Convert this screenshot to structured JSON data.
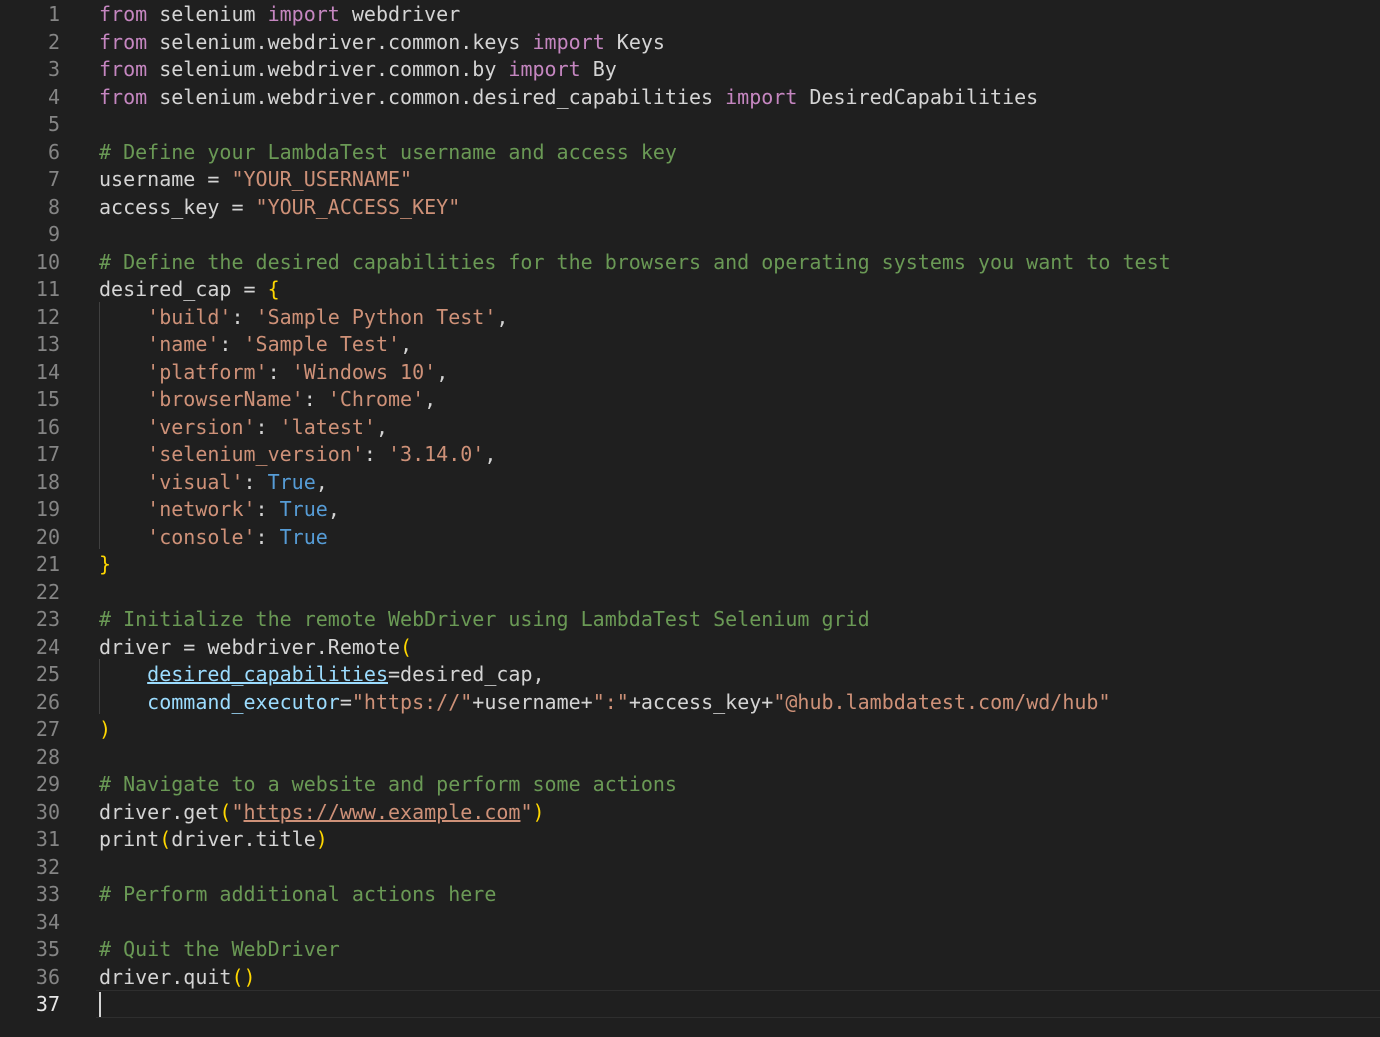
{
  "editor": {
    "language": "python",
    "active_line": 37,
    "colors": {
      "background": "#1f1f1f",
      "keyword": "#c586c0",
      "comment": "#6a9955",
      "string": "#ce9178",
      "constant": "#569cd6",
      "bracket": "#ffd700",
      "parameter": "#9cdcfe",
      "function": "#dcdcaa",
      "text": "#d4d4d4",
      "line_number": "#858585"
    },
    "lines": [
      {
        "n": "1",
        "tokens": [
          [
            "kw",
            "from"
          ],
          [
            "tx",
            " selenium "
          ],
          [
            "kw",
            "import"
          ],
          [
            "tx",
            " webdriver"
          ]
        ]
      },
      {
        "n": "2",
        "tokens": [
          [
            "kw",
            "from"
          ],
          [
            "tx",
            " selenium.webdriver.common.keys "
          ],
          [
            "kw",
            "import"
          ],
          [
            "tx",
            " Keys"
          ]
        ]
      },
      {
        "n": "3",
        "tokens": [
          [
            "kw",
            "from"
          ],
          [
            "tx",
            " selenium.webdriver.common.by "
          ],
          [
            "kw",
            "import"
          ],
          [
            "tx",
            " By"
          ]
        ]
      },
      {
        "n": "4",
        "tokens": [
          [
            "kw",
            "from"
          ],
          [
            "tx",
            " selenium.webdriver.common.desired_capabilities "
          ],
          [
            "kw",
            "import"
          ],
          [
            "tx",
            " DesiredCapabilities"
          ]
        ]
      },
      {
        "n": "5",
        "tokens": []
      },
      {
        "n": "6",
        "tokens": [
          [
            "cm",
            "# Define your LambdaTest username and access key"
          ]
        ]
      },
      {
        "n": "7",
        "tokens": [
          [
            "tx",
            "username = "
          ],
          [
            "st",
            "\"YOUR_USERNAME\""
          ]
        ]
      },
      {
        "n": "8",
        "tokens": [
          [
            "tx",
            "access_key = "
          ],
          [
            "st",
            "\"YOUR_ACCESS_KEY\""
          ]
        ]
      },
      {
        "n": "9",
        "tokens": []
      },
      {
        "n": "10",
        "tokens": [
          [
            "cm",
            "# Define the desired capabilities for the browsers and operating systems you want to test"
          ]
        ]
      },
      {
        "n": "11",
        "tokens": [
          [
            "tx",
            "desired_cap = "
          ],
          [
            "bk",
            "{"
          ]
        ]
      },
      {
        "n": "12",
        "tokens": [
          [
            "tx",
            "    "
          ],
          [
            "st",
            "'build'"
          ],
          [
            "tx",
            ": "
          ],
          [
            "st",
            "'Sample Python Test'"
          ],
          [
            "tx",
            ","
          ]
        ]
      },
      {
        "n": "13",
        "tokens": [
          [
            "tx",
            "    "
          ],
          [
            "st",
            "'name'"
          ],
          [
            "tx",
            ": "
          ],
          [
            "st",
            "'Sample Test'"
          ],
          [
            "tx",
            ","
          ]
        ]
      },
      {
        "n": "14",
        "tokens": [
          [
            "tx",
            "    "
          ],
          [
            "st",
            "'platform'"
          ],
          [
            "tx",
            ": "
          ],
          [
            "st",
            "'Windows 10'"
          ],
          [
            "tx",
            ","
          ]
        ]
      },
      {
        "n": "15",
        "tokens": [
          [
            "tx",
            "    "
          ],
          [
            "st",
            "'browserName'"
          ],
          [
            "tx",
            ": "
          ],
          [
            "st",
            "'Chrome'"
          ],
          [
            "tx",
            ","
          ]
        ]
      },
      {
        "n": "16",
        "tokens": [
          [
            "tx",
            "    "
          ],
          [
            "st",
            "'version'"
          ],
          [
            "tx",
            ": "
          ],
          [
            "st",
            "'latest'"
          ],
          [
            "tx",
            ","
          ]
        ]
      },
      {
        "n": "17",
        "tokens": [
          [
            "tx",
            "    "
          ],
          [
            "st",
            "'selenium_version'"
          ],
          [
            "tx",
            ": "
          ],
          [
            "st",
            "'3.14.0'"
          ],
          [
            "tx",
            ","
          ]
        ]
      },
      {
        "n": "18",
        "tokens": [
          [
            "tx",
            "    "
          ],
          [
            "st",
            "'visual'"
          ],
          [
            "tx",
            ": "
          ],
          [
            "bi",
            "True"
          ],
          [
            "tx",
            ","
          ]
        ]
      },
      {
        "n": "19",
        "tokens": [
          [
            "tx",
            "    "
          ],
          [
            "st",
            "'network'"
          ],
          [
            "tx",
            ": "
          ],
          [
            "bi",
            "True"
          ],
          [
            "tx",
            ","
          ]
        ]
      },
      {
        "n": "20",
        "tokens": [
          [
            "tx",
            "    "
          ],
          [
            "st",
            "'console'"
          ],
          [
            "tx",
            ": "
          ],
          [
            "bi",
            "True"
          ]
        ]
      },
      {
        "n": "21",
        "tokens": [
          [
            "bk",
            "}"
          ]
        ]
      },
      {
        "n": "22",
        "tokens": []
      },
      {
        "n": "23",
        "tokens": [
          [
            "cm",
            "# Initialize the remote WebDriver using LambdaTest Selenium grid"
          ]
        ]
      },
      {
        "n": "24",
        "tokens": [
          [
            "tx",
            "driver = webdriver.Remote"
          ],
          [
            "bk",
            "("
          ]
        ]
      },
      {
        "n": "25",
        "tokens": [
          [
            "tx",
            "    "
          ],
          [
            "pr ul",
            "desired_capabilities"
          ],
          [
            "tx",
            "=desired_cap,"
          ]
        ]
      },
      {
        "n": "26",
        "tokens": [
          [
            "tx",
            "    "
          ],
          [
            "pr",
            "command_executor"
          ],
          [
            "tx",
            "="
          ],
          [
            "st",
            "\"https://\""
          ],
          [
            "tx",
            "+username+"
          ],
          [
            "st",
            "\":\""
          ],
          [
            "tx",
            "+access_key+"
          ],
          [
            "st",
            "\"@hub.lambdatest.com/wd/hub\""
          ]
        ]
      },
      {
        "n": "27",
        "tokens": [
          [
            "bk",
            ")"
          ]
        ]
      },
      {
        "n": "28",
        "tokens": []
      },
      {
        "n": "29",
        "tokens": [
          [
            "cm",
            "# Navigate to a website and perform some actions"
          ]
        ]
      },
      {
        "n": "30",
        "tokens": [
          [
            "tx",
            "driver.get"
          ],
          [
            "bk",
            "("
          ],
          [
            "st",
            "\""
          ],
          [
            "st ul",
            "https://www.example.com"
          ],
          [
            "st",
            "\""
          ],
          [
            "bk",
            ")"
          ]
        ]
      },
      {
        "n": "31",
        "tokens": [
          [
            "tx",
            "print"
          ],
          [
            "bk",
            "("
          ],
          [
            "tx",
            "driver.title"
          ],
          [
            "bk",
            ")"
          ]
        ]
      },
      {
        "n": "32",
        "tokens": []
      },
      {
        "n": "33",
        "tokens": [
          [
            "cm",
            "# Perform additional actions here"
          ]
        ]
      },
      {
        "n": "34",
        "tokens": []
      },
      {
        "n": "35",
        "tokens": [
          [
            "cm",
            "# Quit the WebDriver"
          ]
        ]
      },
      {
        "n": "36",
        "tokens": [
          [
            "tx",
            "driver.quit"
          ],
          [
            "bk",
            "()"
          ]
        ]
      },
      {
        "n": "37",
        "tokens": []
      }
    ]
  }
}
